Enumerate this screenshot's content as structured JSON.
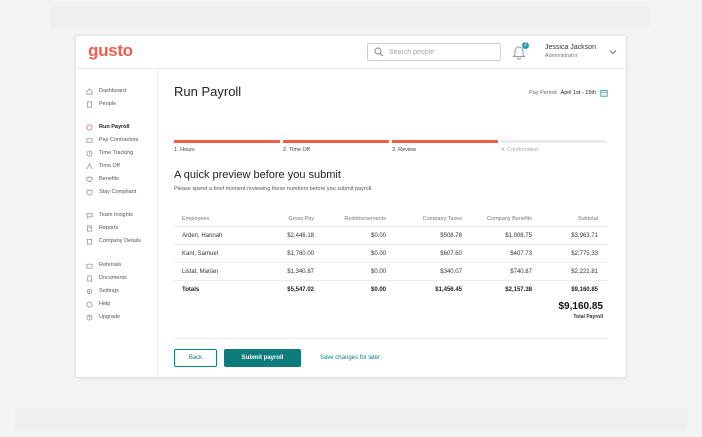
{
  "app": {
    "logo": "gusto",
    "search_placeholder": "Search people",
    "notification_count": "2",
    "user_name": "Jessica Jackson",
    "user_role": "Administrator",
    "brand_color": "#f45d48",
    "accent_color": "#0e7c7c"
  },
  "sidebar": {
    "items": [
      {
        "label": "Dashboard",
        "icon": "home-icon"
      },
      {
        "label": "People",
        "icon": "person-icon"
      },
      {
        "label": "Run Payroll",
        "icon": "dollar-icon"
      },
      {
        "label": "Pay Contractors",
        "icon": "contractors-icon"
      },
      {
        "label": "Time Tracking",
        "icon": "clock-icon"
      },
      {
        "label": "Time Off",
        "icon": "time-off-icon"
      },
      {
        "label": "Benefits",
        "icon": "heart-icon"
      },
      {
        "label": "Stay Compliant",
        "icon": "shield-icon"
      },
      {
        "label": "Team Insights",
        "icon": "chat-icon"
      },
      {
        "label": "Reports",
        "icon": "reports-icon"
      },
      {
        "label": "Company Details",
        "icon": "building-icon"
      },
      {
        "label": "Referrals",
        "icon": "referral-icon"
      },
      {
        "label": "Documents",
        "icon": "document-icon"
      },
      {
        "label": "Settings",
        "icon": "gear-icon"
      },
      {
        "label": "Help",
        "icon": "help-icon"
      },
      {
        "label": "Upgrade",
        "icon": "upgrade-icon"
      }
    ]
  },
  "main": {
    "title": "Run Payroll",
    "pay_period_label": "Pay Period:",
    "pay_period_value": "April 1st - 15th",
    "steps": [
      {
        "label": "1. Hours",
        "state": "done"
      },
      {
        "label": "2. Time Off",
        "state": "done"
      },
      {
        "label": "3. Review",
        "state": "done"
      },
      {
        "label": "4. Confirmation",
        "state": "todo"
      }
    ],
    "heading": "A quick preview before you submit",
    "subheading": "Please spend a brief moment reviewing these numbers before you submit payroll."
  },
  "table": {
    "headers": [
      "Employees",
      "Gross Pay",
      "Reimbursements",
      "Company Taxes",
      "Company Benefits",
      "Subtotal"
    ],
    "rows": [
      [
        "Arden, Hannah",
        "$2,446.18",
        "$0.00",
        "$508.78",
        "$1,008.75",
        "$3,963.71"
      ],
      [
        "Kant, Samuel",
        "$1,760.00",
        "$0.00",
        "$607.60",
        "$407.73",
        "$2,775.33"
      ],
      [
        "Listat, Marian",
        "$1,340.87",
        "$0.00",
        "$340.07",
        "$740.87",
        "$2,221.81"
      ]
    ],
    "totals": [
      "Totals",
      "$5,547.02",
      "$0.00",
      "$1,456.45",
      "$2,157.38",
      "$9,160.85"
    ],
    "grand_total": "$9,160.85",
    "grand_total_label": "Total Payroll"
  },
  "footer": {
    "back": "Back",
    "submit": "Submit payroll",
    "save": "Save changes for later"
  }
}
